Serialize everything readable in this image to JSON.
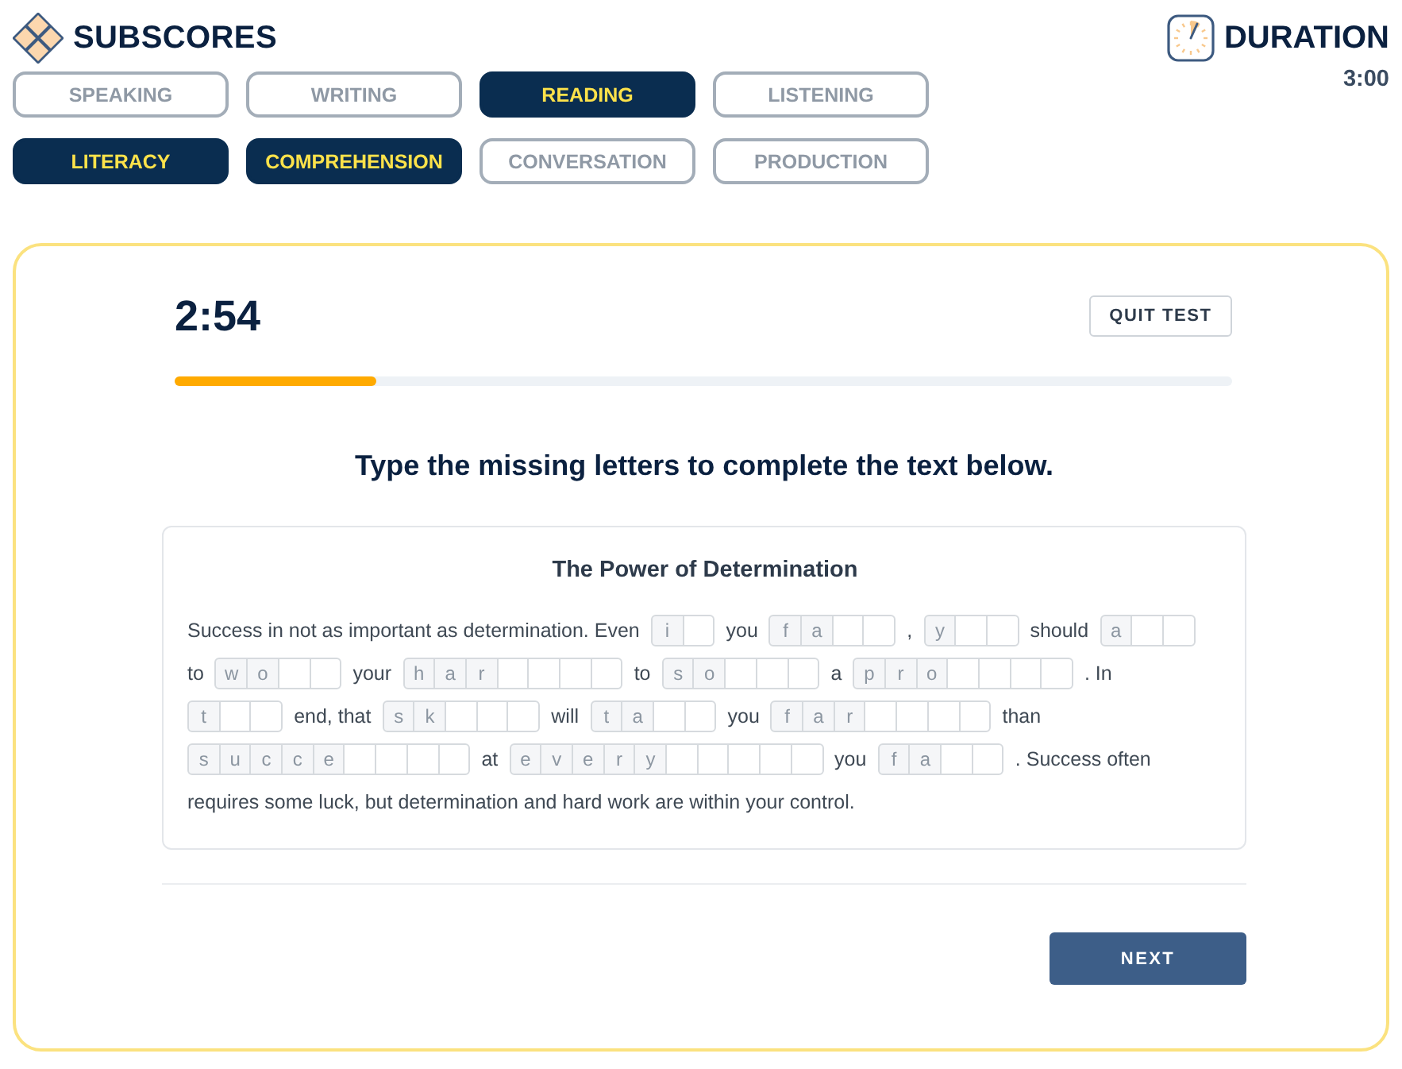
{
  "header": {
    "title": "SUBSCORES",
    "skill_tabs": [
      {
        "label": "SPEAKING",
        "selected": false
      },
      {
        "label": "WRITING",
        "selected": false
      },
      {
        "label": "READING",
        "selected": true
      },
      {
        "label": "LISTENING",
        "selected": false
      }
    ],
    "subskill_tabs": [
      {
        "label": "LITERACY",
        "selected": true
      },
      {
        "label": "COMPREHENSION",
        "selected": true
      },
      {
        "label": "CONVERSATION",
        "selected": false
      },
      {
        "label": "PRODUCTION",
        "selected": false
      }
    ]
  },
  "duration": {
    "label": "DURATION",
    "value": "3:00"
  },
  "test": {
    "timer": "2:54",
    "quit_button": "QUIT TEST",
    "progress": {
      "level": 0.19
    },
    "instruction": "Type the missing letters to complete the text below.",
    "passage": {
      "title": "The Power of Determination",
      "lines": [
        {
          "segments": [
            {
              "kind": "text",
              "text": "Success in not as important as determination. Even"
            },
            {
              "kind": "blank",
              "cells": [
                {
                  "kind": "given",
                  "letter": "i"
                },
                {
                  "kind": "input"
                }
              ]
            },
            {
              "kind": "text",
              "text": "you"
            },
            {
              "kind": "blank",
              "cells": [
                {
                  "kind": "given",
                  "letter": "f"
                },
                {
                  "kind": "given",
                  "letter": "a"
                },
                {
                  "kind": "input"
                },
                {
                  "kind": "input"
                }
              ]
            },
            {
              "kind": "text",
              "text": ","
            },
            {
              "kind": "blank",
              "cells": [
                {
                  "kind": "given",
                  "letter": "y"
                },
                {
                  "kind": "input"
                },
                {
                  "kind": "input"
                }
              ]
            },
            {
              "kind": "text",
              "text": "should"
            },
            {
              "kind": "blank",
              "cells": [
                {
                  "kind": "given",
                  "letter": "a"
                },
                {
                  "kind": "input"
                },
                {
                  "kind": "input"
                }
              ]
            }
          ]
        },
        {
          "segments": [
            {
              "kind": "text",
              "text": "to"
            },
            {
              "kind": "blank",
              "cells": [
                {
                  "kind": "given",
                  "letter": "w"
                },
                {
                  "kind": "given",
                  "letter": "o"
                },
                {
                  "kind": "input"
                },
                {
                  "kind": "input"
                }
              ]
            },
            {
              "kind": "text",
              "text": "your"
            },
            {
              "kind": "blank",
              "cells": [
                {
                  "kind": "given",
                  "letter": "h"
                },
                {
                  "kind": "given",
                  "letter": "a"
                },
                {
                  "kind": "given",
                  "letter": "r"
                },
                {
                  "kind": "input"
                },
                {
                  "kind": "input"
                },
                {
                  "kind": "input"
                },
                {
                  "kind": "input"
                }
              ]
            },
            {
              "kind": "text",
              "text": "to"
            },
            {
              "kind": "blank",
              "cells": [
                {
                  "kind": "given",
                  "letter": "s"
                },
                {
                  "kind": "given",
                  "letter": "o"
                },
                {
                  "kind": "input"
                },
                {
                  "kind": "input"
                },
                {
                  "kind": "input"
                }
              ]
            },
            {
              "kind": "text",
              "text": "a"
            },
            {
              "kind": "blank",
              "cells": [
                {
                  "kind": "given",
                  "letter": "p"
                },
                {
                  "kind": "given",
                  "letter": "r"
                },
                {
                  "kind": "given",
                  "letter": "o"
                },
                {
                  "kind": "input"
                },
                {
                  "kind": "input"
                },
                {
                  "kind": "input"
                },
                {
                  "kind": "input"
                }
              ]
            },
            {
              "kind": "text",
              "text": ". In"
            }
          ]
        },
        {
          "segments": [
            {
              "kind": "blank",
              "cells": [
                {
                  "kind": "given",
                  "letter": "t"
                },
                {
                  "kind": "input"
                },
                {
                  "kind": "input"
                }
              ]
            },
            {
              "kind": "text",
              "text": "end, that"
            },
            {
              "kind": "blank",
              "cells": [
                {
                  "kind": "given",
                  "letter": "s"
                },
                {
                  "kind": "given",
                  "letter": "k"
                },
                {
                  "kind": "input"
                },
                {
                  "kind": "input"
                },
                {
                  "kind": "input"
                }
              ]
            },
            {
              "kind": "text",
              "text": "will"
            },
            {
              "kind": "blank",
              "cells": [
                {
                  "kind": "given",
                  "letter": "t"
                },
                {
                  "kind": "given",
                  "letter": "a"
                },
                {
                  "kind": "input"
                },
                {
                  "kind": "input"
                }
              ]
            },
            {
              "kind": "text",
              "text": "you"
            },
            {
              "kind": "blank",
              "cells": [
                {
                  "kind": "given",
                  "letter": "f"
                },
                {
                  "kind": "given",
                  "letter": "a"
                },
                {
                  "kind": "given",
                  "letter": "r"
                },
                {
                  "kind": "input"
                },
                {
                  "kind": "input"
                },
                {
                  "kind": "input"
                },
                {
                  "kind": "input"
                }
              ]
            },
            {
              "kind": "text",
              "text": "than"
            }
          ]
        },
        {
          "segments": [
            {
              "kind": "blank",
              "cells": [
                {
                  "kind": "given",
                  "letter": "s"
                },
                {
                  "kind": "given",
                  "letter": "u"
                },
                {
                  "kind": "given",
                  "letter": "c"
                },
                {
                  "kind": "given",
                  "letter": "c"
                },
                {
                  "kind": "given",
                  "letter": "e"
                },
                {
                  "kind": "input"
                },
                {
                  "kind": "input"
                },
                {
                  "kind": "input"
                },
                {
                  "kind": "input"
                }
              ]
            },
            {
              "kind": "text",
              "text": "at"
            },
            {
              "kind": "blank",
              "cells": [
                {
                  "kind": "given",
                  "letter": "e"
                },
                {
                  "kind": "given",
                  "letter": "v"
                },
                {
                  "kind": "given",
                  "letter": "e"
                },
                {
                  "kind": "given",
                  "letter": "r"
                },
                {
                  "kind": "given",
                  "letter": "y"
                },
                {
                  "kind": "input"
                },
                {
                  "kind": "input"
                },
                {
                  "kind": "input"
                },
                {
                  "kind": "input"
                },
                {
                  "kind": "input"
                }
              ]
            },
            {
              "kind": "text",
              "text": "you"
            },
            {
              "kind": "blank",
              "cells": [
                {
                  "kind": "given",
                  "letter": "f"
                },
                {
                  "kind": "given",
                  "letter": "a"
                },
                {
                  "kind": "input"
                },
                {
                  "kind": "input"
                }
              ]
            },
            {
              "kind": "text",
              "text": ". Success often"
            }
          ]
        },
        {
          "segments": [
            {
              "kind": "text",
              "text": "requires some luck, but determination and hard work are within your control."
            }
          ]
        }
      ]
    },
    "next_button": "NEXT"
  }
}
